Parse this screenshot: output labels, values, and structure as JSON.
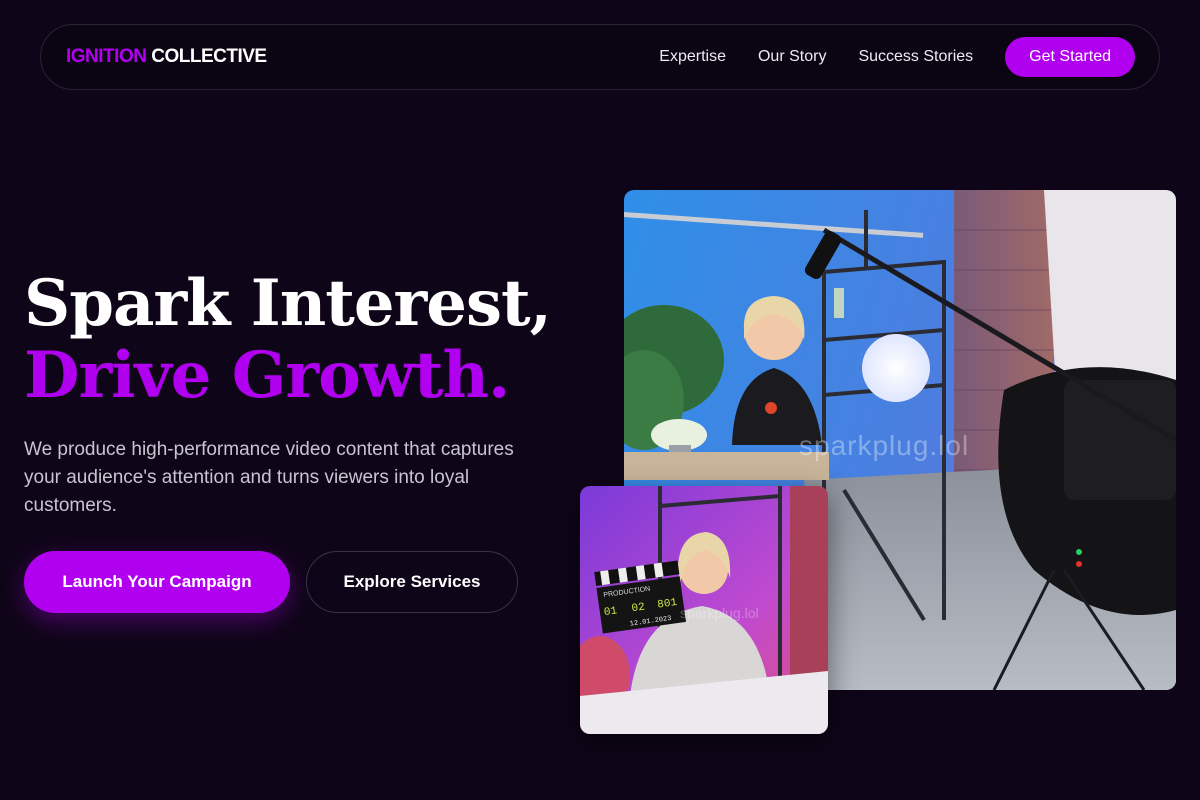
{
  "nav": {
    "logo_accent": "IGNITION",
    "logo_rest": "COLLECTIVE",
    "links": [
      "Expertise",
      "Our Story",
      "Success Stories"
    ],
    "cta": "Get Started"
  },
  "hero": {
    "headline_line1": "Spark Interest,",
    "headline_line2": "Drive Growth.",
    "subtitle": "We produce high-performance video content that captures your audience's attention and turns viewers into loyal customers.",
    "primary_button": "Launch Your Campaign",
    "secondary_button": "Explore Services"
  },
  "images": {
    "main_watermark": "sparkplug.lol",
    "small_watermark": "sparkplug.lol",
    "clapper": {
      "header": "PRODUCTION",
      "roll": "01",
      "scene": "02",
      "take": "801",
      "date": "12.01.2023"
    }
  },
  "colors": {
    "accent": "#b100f0",
    "background": "#0f0518"
  }
}
